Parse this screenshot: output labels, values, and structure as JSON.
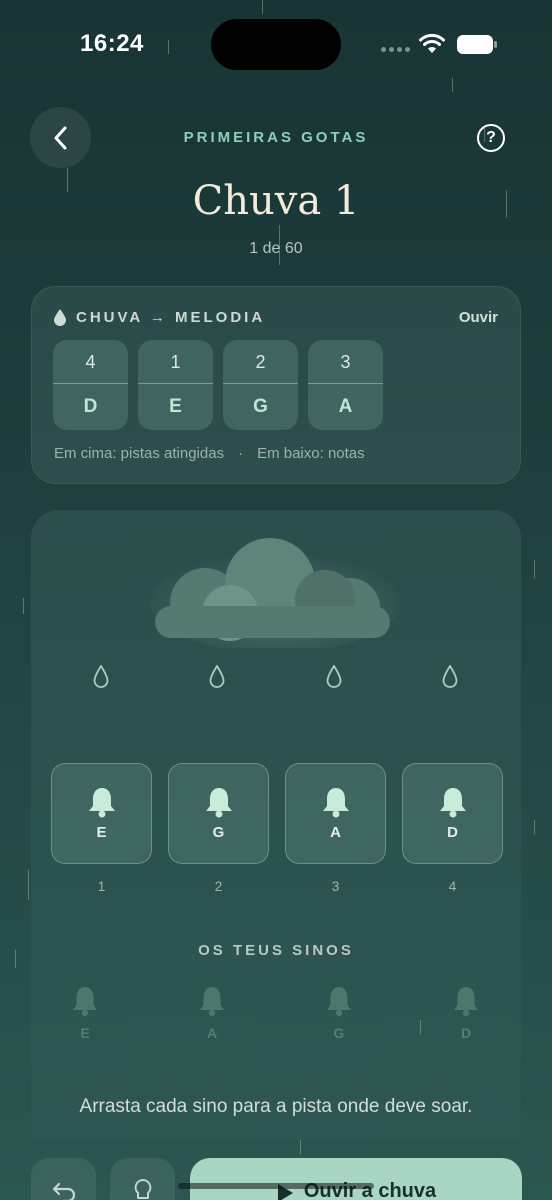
{
  "status": {
    "time": "16:24"
  },
  "header": {
    "back_icon": "chevron-left-icon",
    "help_label": "?",
    "kicker": "PRIMEIRAS GOTAS",
    "title": "Chuva 1",
    "subtitle": "1 de 60"
  },
  "melody_card": {
    "label": "CHUVA → MELODIA",
    "listen_label": "Ouvir",
    "chips": [
      {
        "track": "4",
        "note": "D"
      },
      {
        "track": "1",
        "note": "E"
      },
      {
        "track": "2",
        "note": "G"
      },
      {
        "track": "3",
        "note": "A"
      }
    ],
    "legend_top": "Em cima: pistas atingidas",
    "legend_sep": "·",
    "legend_bottom": "Em baixo: notas"
  },
  "tracks": [
    {
      "number": "1",
      "bell_note": "E"
    },
    {
      "number": "2",
      "bell_note": "G"
    },
    {
      "number": "3",
      "bell_note": "A"
    },
    {
      "number": "4",
      "bell_note": "D"
    }
  ],
  "your_bells": {
    "title": "OS TEUS SINOS",
    "bells": [
      "E",
      "A",
      "G",
      "D"
    ]
  },
  "instruction": "Arrasta cada sino para a pista onde deve soar.",
  "bottom": {
    "undo_icon": "undo-icon",
    "hint_icon": "lightbulb-icon",
    "play_icon": "play-icon",
    "listen_label": "Ouvir a chuva"
  },
  "colors": {
    "accent": "#a9d6c2",
    "kicker": "#8fcfb8",
    "title": "#f3ead8"
  }
}
